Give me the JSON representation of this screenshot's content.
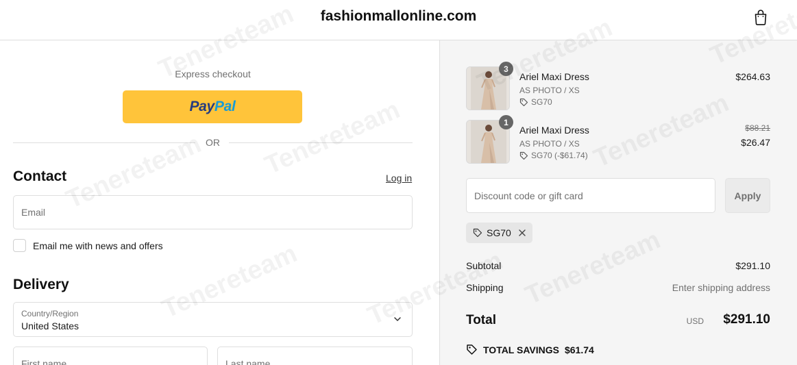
{
  "header": {
    "site_name": "fashionmallonline.com",
    "cart_icon": "shopping-bag-icon"
  },
  "express": {
    "label": "Express checkout",
    "paypal_part1": "Pay",
    "paypal_part2": "Pal",
    "or_text": "OR"
  },
  "contact": {
    "title": "Contact",
    "login_label": "Log in",
    "email_placeholder": "Email",
    "newsletter_label": "Email me with news and offers"
  },
  "delivery": {
    "title": "Delivery",
    "country_label": "Country/Region",
    "country_value": "United States",
    "first_name_placeholder": "First name",
    "last_name_placeholder": "Last name"
  },
  "order": {
    "items": [
      {
        "quantity": "3",
        "name": "Ariel Maxi Dress",
        "variant": "AS PHOTO / XS",
        "discount_code": "SG70",
        "price": "$264.63"
      },
      {
        "quantity": "1",
        "name": "Ariel Maxi Dress",
        "variant": "AS PHOTO / XS",
        "discount_code": "SG70 (-$61.74)",
        "original_price": "$88.21",
        "price": "$26.47"
      }
    ],
    "discount_placeholder": "Discount code or gift card",
    "apply_label": "Apply",
    "applied_code": "SG70",
    "subtotal_label": "Subtotal",
    "subtotal_value": "$291.10",
    "shipping_label": "Shipping",
    "shipping_value": "Enter shipping address",
    "total_label": "Total",
    "total_currency": "USD",
    "total_value": "$291.10",
    "savings_label": "TOTAL SAVINGS",
    "savings_value": "$61.74"
  },
  "watermark_text": "Tenereteam",
  "colors": {
    "paypal_button": "#ffc43a",
    "summary_background": "#f5f5f5",
    "paypal_dark": "#253b80",
    "paypal_light": "#179bd7"
  }
}
